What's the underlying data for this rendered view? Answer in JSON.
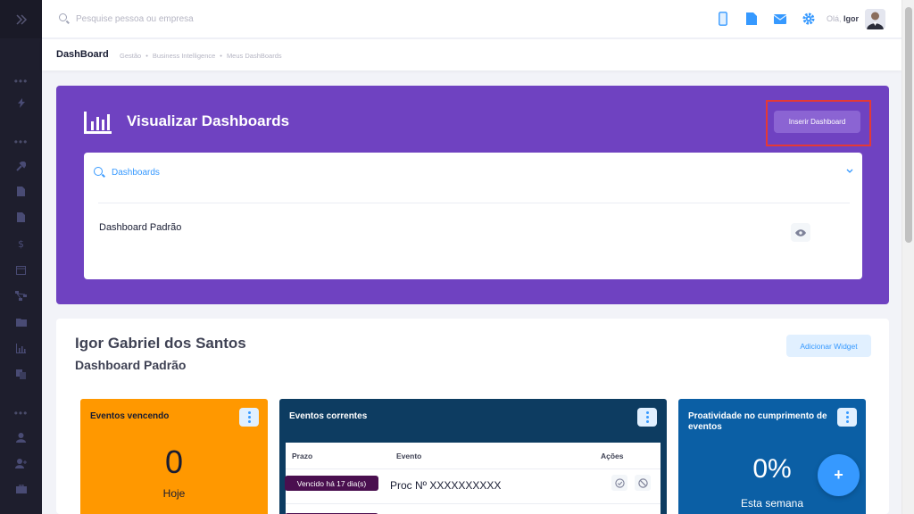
{
  "header": {
    "search_placeholder": "Pesquise pessoa ou empresa",
    "greeting": "Olá,",
    "user": "Igor",
    "icons": [
      "mobile-icon",
      "file-icon",
      "mail-icon",
      "gear-icon"
    ]
  },
  "subheader": {
    "title": "DashBoard",
    "breadcrumbs": [
      "Gestão",
      "Business Intelligence",
      "Meus DashBoards"
    ]
  },
  "panel": {
    "title": "Visualizar Dashboards",
    "insert_button": "Inserir Dashboard",
    "accordion_label": "Dashboards",
    "dashboard_item": "Dashboard Padrão"
  },
  "dashboard": {
    "user_name": "Igor Gabriel dos Santos",
    "dashboard_name": "Dashboard Padrão",
    "add_widget": "Adicionar Widget"
  },
  "widgets": {
    "due": {
      "title": "Eventos vencendo",
      "value": "0",
      "period": "Hoje"
    },
    "current": {
      "title": "Eventos correntes",
      "columns": [
        "Prazo",
        "Evento",
        "Ações"
      ],
      "rows": [
        {
          "deadline": "Vencido há 17 dia(s)",
          "event": "Proc Nº XXXXXXXXXX"
        }
      ]
    },
    "proactivity": {
      "title": "Proatividade no cumprimento de eventos",
      "value": "0%",
      "period": "Esta semana"
    }
  },
  "fab_label": "+",
  "colors": {
    "purple": "#6f42c1",
    "orange": "#ff9800",
    "navy": "#0d3c61",
    "blue": "#0b5fa5",
    "accent": "#3699ff"
  }
}
